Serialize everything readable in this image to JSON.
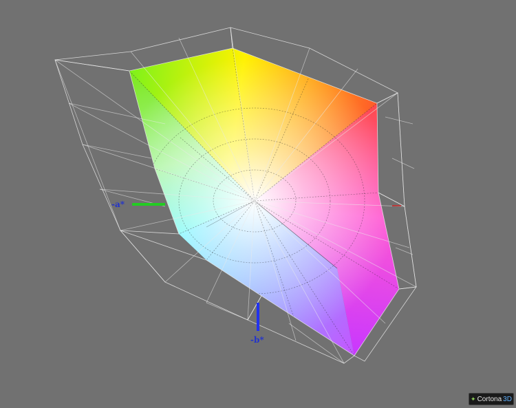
{
  "viewer": {
    "background_color": "#717171",
    "axis_labels": {
      "neg_a": "-a*",
      "neg_b": "-b*"
    },
    "axis_colors": {
      "a_neg": "#22cc22",
      "a_pos": "#cc2222",
      "b_neg": "#2233ee"
    },
    "logo": {
      "text": "Cortona",
      "accent": "3D",
      "icon": "cortona-star-icon"
    }
  }
}
